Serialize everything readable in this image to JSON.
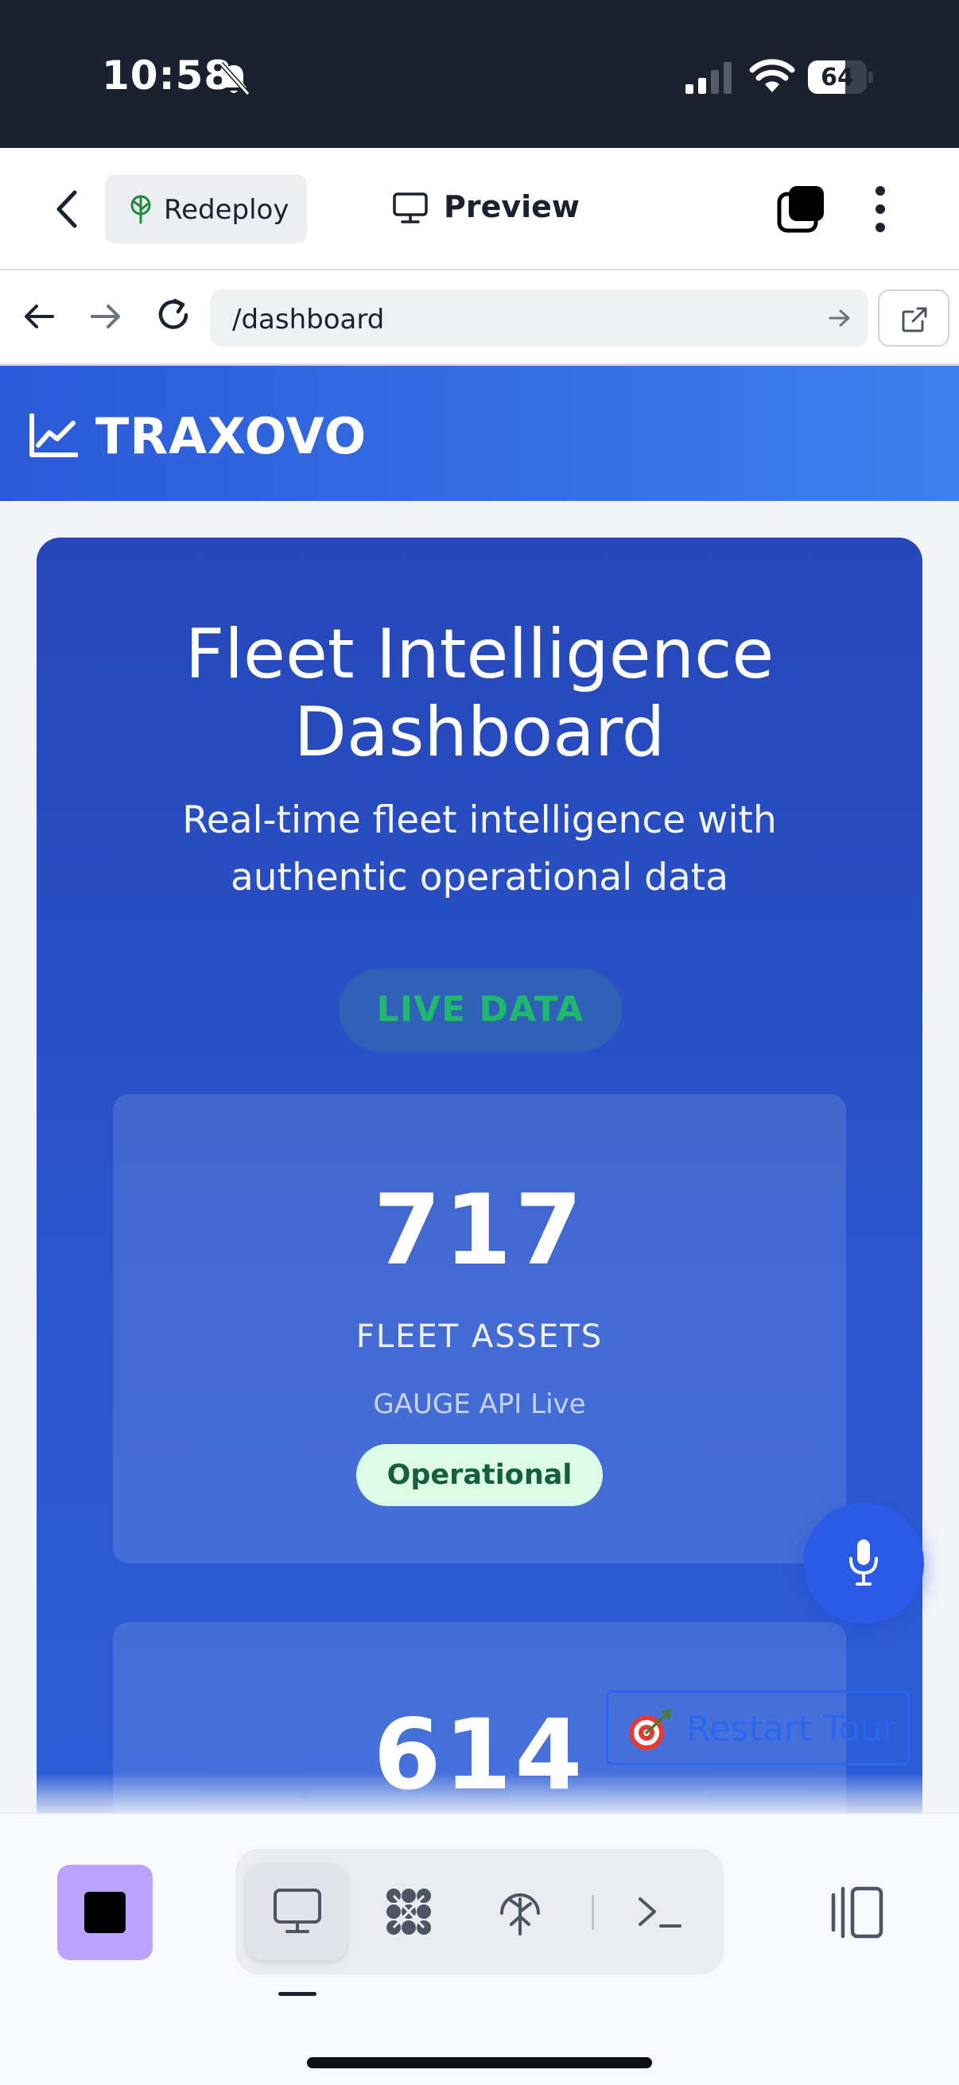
{
  "status_bar": {
    "time": "10:58",
    "battery": "64",
    "battery_level": 0.64
  },
  "header": {
    "redeploy_label": "Redeploy",
    "preview_label": "Preview"
  },
  "browser": {
    "url": "/dashboard"
  },
  "app": {
    "brand": "TRAXOVO"
  },
  "hero": {
    "title": "Fleet Intelligence Dashboard",
    "subtitle": "Real-time fleet intelligence with authentic operational data",
    "live_badge": "LIVE DATA"
  },
  "stats": [
    {
      "value": "717",
      "label": "FLEET ASSETS",
      "source": "GAUGE API Live",
      "status": "Operational"
    },
    {
      "value": "614"
    }
  ],
  "tour": {
    "label": "Restart Tour"
  },
  "colors": {
    "brand_blue": "#2b5ad8",
    "hero_blue": "#2647b9",
    "live_green": "#1fb86f",
    "stop_purple": "#b9a3ff"
  },
  "icons": {
    "status_bar": [
      "bell-slash-icon",
      "signal-icon",
      "wifi-icon",
      "battery-icon"
    ],
    "toolbar": [
      "stop-icon",
      "desktop-icon",
      "workflows-icon",
      "deploy-icon",
      "terminal-icon",
      "panel-icon"
    ]
  }
}
